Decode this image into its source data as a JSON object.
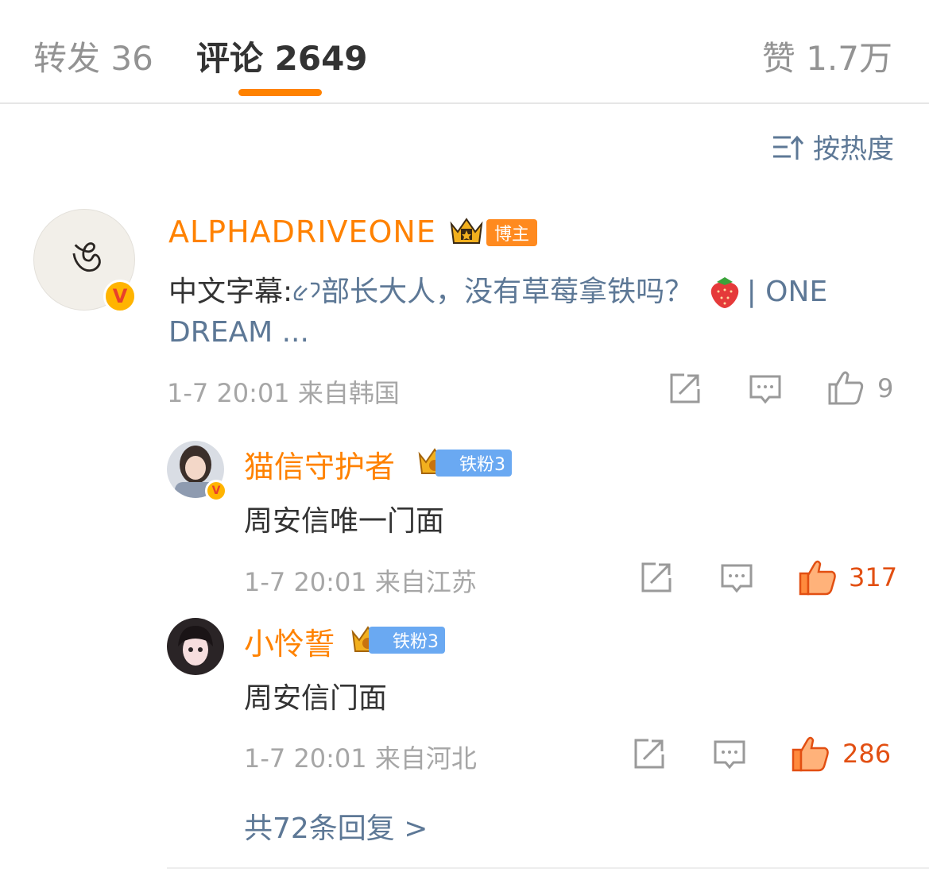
{
  "tabs": {
    "repost_label": "转发",
    "repost_count": "36",
    "comments_label": "评论",
    "comments_count": "2649",
    "likes_label": "赞",
    "likes_count": "1.7万"
  },
  "sort": {
    "label": "按热度",
    "icon": "sort-icon"
  },
  "main_comment": {
    "author": "ALPHADRIVEONE",
    "avatar_mark": "ঙ",
    "tag": "博主",
    "text_prefix": "中文字幕:",
    "link_text": "部长大人，没有草莓拿铁吗？",
    "link_suffix": "| ONE",
    "link_line2": "DREAM ...",
    "time": "1-7 20:01",
    "location": "来自韩国",
    "likes": "9"
  },
  "replies": [
    {
      "author": "猫信守护者",
      "fan_tag": "铁粉3",
      "text": "周安信唯一门面",
      "time": "1-7 20:01",
      "location": "来自江苏",
      "likes": "317"
    },
    {
      "author": "小怜誓",
      "fan_tag": "铁粉3",
      "text": "周安信门面",
      "time": "1-7 20:01",
      "location": "来自河北",
      "likes": "286"
    }
  ],
  "more_replies": "共72条回复 >",
  "colors": {
    "accent": "#ff8200",
    "link": "#5d7896",
    "meta": "#a6a6a6",
    "text": "#333333"
  }
}
